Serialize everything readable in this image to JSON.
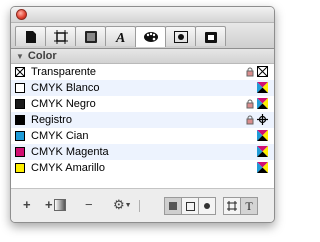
{
  "panel": {
    "section_title": "Color"
  },
  "tabs": [
    {
      "name": "page-icon"
    },
    {
      "name": "frame-icon"
    },
    {
      "name": "box-icon"
    },
    {
      "name": "character-icon"
    },
    {
      "name": "palette-icon"
    },
    {
      "name": "picture-icon"
    },
    {
      "name": "clip-icon"
    }
  ],
  "colors": [
    {
      "label": "Transparente",
      "swatch": "none",
      "locked": true,
      "type": "none"
    },
    {
      "label": "CMYK Blanco",
      "swatch": "#ffffff",
      "locked": false,
      "type": "cmyk"
    },
    {
      "label": "CMYK Negro",
      "swatch": "#1a1a1a",
      "locked": true,
      "type": "cmyk"
    },
    {
      "label": "Registro",
      "swatch": "#000000",
      "locked": true,
      "type": "registration"
    },
    {
      "label": "CMYK Cian",
      "swatch": "#1f9cd8",
      "locked": false,
      "type": "cmyk"
    },
    {
      "label": "CMYK Magenta",
      "swatch": "#d10f73",
      "locked": false,
      "type": "cmyk"
    },
    {
      "label": "CMYK Amarillo",
      "swatch": "#ffef00",
      "locked": false,
      "type": "cmyk"
    }
  ],
  "toolbar": {
    "add": "+",
    "add_gradient": "+",
    "remove": "−",
    "gear": "⚙",
    "text_mode": "T"
  }
}
